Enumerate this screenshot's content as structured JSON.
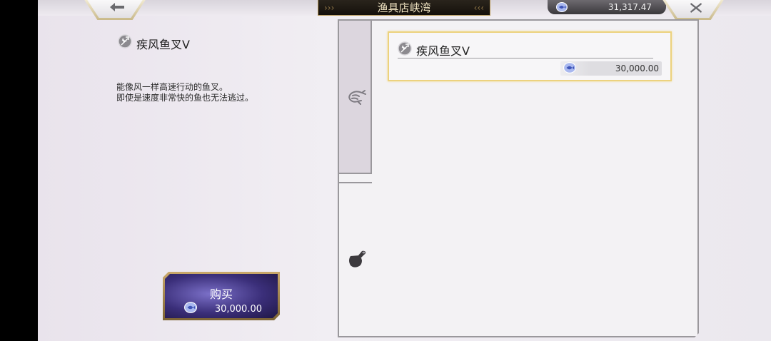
{
  "header": {
    "title": "渔具店峡湾",
    "currency_amount": "31,317.47",
    "back_icon": "back-arrow-icon",
    "close_icon": "close-icon"
  },
  "detail": {
    "item_name": "疾风鱼叉Ⅴ",
    "description_lines": [
      "能像风一样高速行动的鱼叉。",
      "即使是速度非常快的鱼也无法逃过。"
    ]
  },
  "buy": {
    "label": "购买",
    "price": "30,000.00"
  },
  "tabs": [
    {
      "icon": "shrimp-icon",
      "active": true
    },
    {
      "icon": "jar-icon",
      "active": false
    }
  ],
  "list": {
    "items": [
      {
        "name": "疾风鱼叉Ⅴ",
        "price": "30,000.00",
        "selected": true
      }
    ]
  },
  "colors": {
    "accent_gold": "#ecd27e",
    "buy_button": "#3b2f7a",
    "title_plate": "#1a150f"
  }
}
